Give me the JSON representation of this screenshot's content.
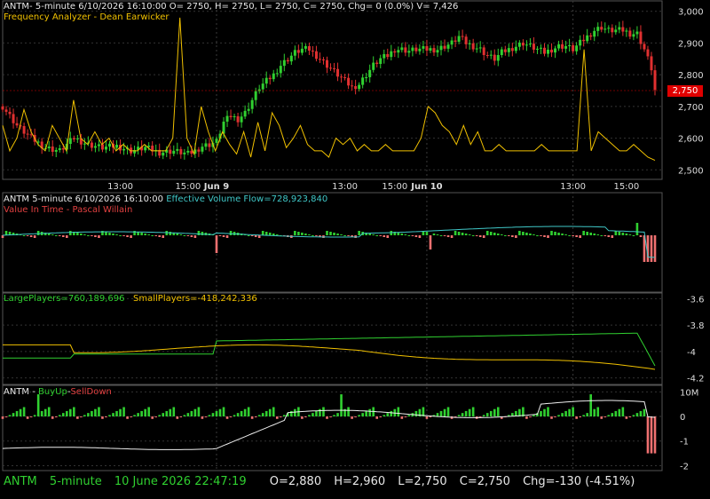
{
  "header": {
    "title": "ANTM- 5-minute 6/10/2026 16:10:00 O= 2750, H= 2750, L= 2750, C= 2750, Chg= 0 (0.0%) V= 7,426",
    "indicator": "Frequency Analyzer - Dean Earwicker"
  },
  "panel2": {
    "title": "ANTM 5-minute  6/10/2026 16:10:00",
    "evf": "Effective Volume Flow=728,923,840",
    "vit": "Value In Time - Pascal Willain"
  },
  "panel3": {
    "large": "LargePlayers=760,189,696",
    "small": "SmallPlayers=-418,242,336"
  },
  "panel4": {
    "prefix": "ANTM - ",
    "buy": "BuyUp",
    "sep": "-",
    "sell": "SellDown"
  },
  "price_tag": "2,750",
  "footer": {
    "symbol": "ANTM",
    "interval": "5-minute",
    "datetime": "10 June 2026 22:47:19",
    "open": "O=2,880",
    "high": "H=2,960",
    "low": "L=2,750",
    "close": "C=2,750",
    "chg": "Chg=-130 (-4.51%)"
  },
  "colors": {
    "background": "#000000",
    "grid": "#333333",
    "up": "#30d030",
    "down": "#e03030",
    "oscillator": "#f0c000",
    "evf": "#40c8c8",
    "price_tag": "#e00000"
  },
  "chart_data": [
    {
      "type": "candlestick",
      "panel": "price",
      "yticks": [
        2500,
        2600,
        2700,
        2800,
        2900,
        3000
      ],
      "ylim": [
        2470,
        3030
      ],
      "xticks": [
        "13:00",
        "15:00",
        "Jun 9",
        "13:00",
        "15:00",
        "Jun 10",
        "13:00",
        "15:00"
      ],
      "last_price": 2750,
      "close_path": [
        [
          0,
          2700
        ],
        [
          4,
          2640
        ],
        [
          8,
          2600
        ],
        [
          12,
          2570
        ],
        [
          16,
          2560
        ],
        [
          20,
          2600
        ],
        [
          24,
          2580
        ],
        [
          28,
          2570
        ],
        [
          32,
          2575
        ],
        [
          36,
          2560
        ],
        [
          40,
          2570
        ],
        [
          44,
          2555
        ],
        [
          48,
          2560
        ],
        [
          52,
          2550
        ],
        [
          54,
          2560
        ],
        [
          56,
          2575
        ],
        [
          58,
          2580
        ],
        [
          60,
          2590
        ],
        [
          62,
          2650
        ],
        [
          64,
          2670
        ],
        [
          66,
          2660
        ],
        [
          68,
          2680
        ],
        [
          70,
          2720
        ],
        [
          72,
          2760
        ],
        [
          74,
          2780
        ],
        [
          76,
          2800
        ],
        [
          78,
          2830
        ],
        [
          80,
          2850
        ],
        [
          82,
          2870
        ],
        [
          84,
          2880
        ],
        [
          86,
          2880
        ],
        [
          88,
          2860
        ],
        [
          90,
          2840
        ],
        [
          92,
          2820
        ],
        [
          94,
          2800
        ],
        [
          96,
          2780
        ],
        [
          98,
          2760
        ],
        [
          100,
          2770
        ],
        [
          102,
          2800
        ],
        [
          104,
          2830
        ],
        [
          106,
          2850
        ],
        [
          108,
          2860
        ],
        [
          110,
          2880
        ],
        [
          112,
          2880
        ],
        [
          114,
          2875
        ],
        [
          116,
          2880
        ],
        [
          118,
          2880
        ],
        [
          120,
          2880
        ],
        [
          122,
          2880
        ],
        [
          124,
          2890
        ],
        [
          126,
          2900
        ],
        [
          128,
          2920
        ],
        [
          130,
          2900
        ],
        [
          132,
          2890
        ],
        [
          134,
          2880
        ],
        [
          136,
          2860
        ],
        [
          138,
          2850
        ],
        [
          140,
          2870
        ],
        [
          142,
          2880
        ],
        [
          144,
          2890
        ],
        [
          146,
          2900
        ],
        [
          148,
          2890
        ],
        [
          150,
          2880
        ],
        [
          152,
          2870
        ],
        [
          154,
          2880
        ],
        [
          156,
          2890
        ],
        [
          158,
          2890
        ],
        [
          160,
          2880
        ],
        [
          162,
          2900
        ],
        [
          164,
          2920
        ],
        [
          166,
          2940
        ],
        [
          168,
          2950
        ],
        [
          170,
          2940
        ],
        [
          172,
          2940
        ],
        [
          174,
          2940
        ],
        [
          176,
          2930
        ],
        [
          178,
          2930
        ],
        [
          180,
          2880
        ],
        [
          182,
          2820
        ],
        [
          183,
          2750
        ]
      ]
    },
    {
      "type": "line",
      "panel": "price",
      "name": "Frequency Analyzer - Dean Earwicker",
      "y": [
        2640,
        2560,
        2600,
        2690,
        2620,
        2580,
        2560,
        2640,
        2600,
        2560,
        2720,
        2600,
        2580,
        2620,
        2580,
        2600,
        2560,
        2580,
        2560,
        2560,
        2580,
        2560,
        2560,
        2560,
        2600,
        2980,
        2600,
        2550,
        2700,
        2620,
        2560,
        2620,
        2580,
        2550,
        2620,
        2540,
        2650,
        2560,
        2680,
        2640,
        2570,
        2600,
        2640,
        2580,
        2560,
        2560,
        2540,
        2600,
        2580,
        2600,
        2560,
        2580,
        2560,
        2560,
        2580,
        2560,
        2560,
        2560,
        2560,
        2600,
        2700,
        2680,
        2640,
        2620,
        2580,
        2640,
        2580,
        2620,
        2560,
        2560,
        2580,
        2560,
        2560,
        2560,
        2560,
        2560,
        2580,
        2560,
        2560,
        2560,
        2560,
        2560,
        2880,
        2560,
        2620,
        2600,
        2580,
        2560,
        2560,
        2580,
        2560,
        2540,
        2530
      ]
    },
    {
      "type": "bar",
      "panel": "value-in-time",
      "series": [
        {
          "name": "Effective Volume Flow",
          "values": [
            728923840
          ]
        }
      ]
    },
    {
      "type": "line",
      "panel": "players",
      "yticks": [
        -3.6,
        -3.8,
        -4,
        -4.2
      ],
      "ylim": [
        -4.25,
        -3.55
      ],
      "series": [
        {
          "name": "LargePlayers",
          "values": [
            760189696
          ]
        },
        {
          "name": "SmallPlayers",
          "values": [
            -418242336
          ]
        }
      ]
    },
    {
      "type": "bar",
      "panel": "buyup-selldown",
      "ytick_labels": [
        "10M",
        "0",
        "-1",
        "-2"
      ],
      "ylim": [
        -2.2,
        1.3
      ]
    }
  ]
}
